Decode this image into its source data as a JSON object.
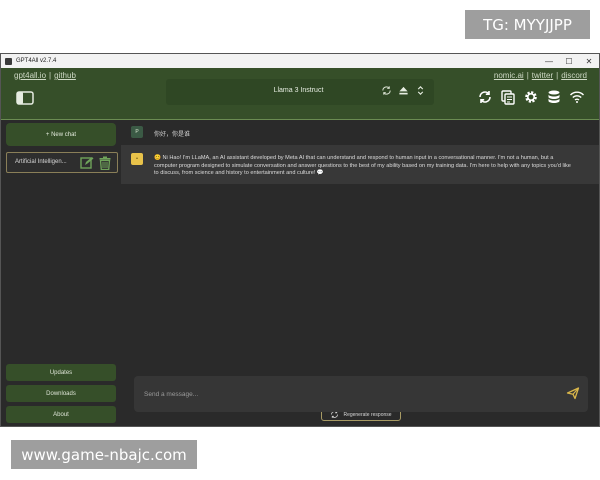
{
  "watermarks": {
    "top": "TG: MYYJJPP",
    "bottom": "www.game-nbajc.com"
  },
  "window": {
    "title": "GPT4All v2.7.4",
    "minimize": "—",
    "maximize": "☐",
    "close": "✕"
  },
  "header": {
    "links_left": [
      "gpt4all.io",
      "github"
    ],
    "links_right": [
      "nomic.ai",
      "twitter",
      "discord"
    ],
    "separator": "|",
    "model_name": "Llama 3 Instruct"
  },
  "sidebar": {
    "new_chat_label": "+ New chat",
    "chats": [
      {
        "title": "Artificial Intelligen..."
      }
    ],
    "updates_label": "Updates",
    "downloads_label": "Downloads",
    "about_label": "About"
  },
  "conversation": {
    "user": {
      "avatar": "P",
      "text": "你好，你是谁"
    },
    "assistant": {
      "avatar": "•",
      "text": "😊 Ni Hao! I'm LLaMA, an AI assistant developed by Meta AI that can understand and respond to human input in a conversational manner. I'm not a human, but a computer program designed to simulate conversation and answer questions to the best of my ability based on my training data. I'm here to help with any topics you'd like to discuss, from science and history to entertainment and culture! 💬"
    },
    "regenerate_label": "Regenerate response"
  },
  "input": {
    "placeholder": "Send a message...",
    "value": ""
  },
  "colors": {
    "header": "#364f29",
    "panel": "#2a2a2a",
    "accent_border": "#a79a64"
  }
}
